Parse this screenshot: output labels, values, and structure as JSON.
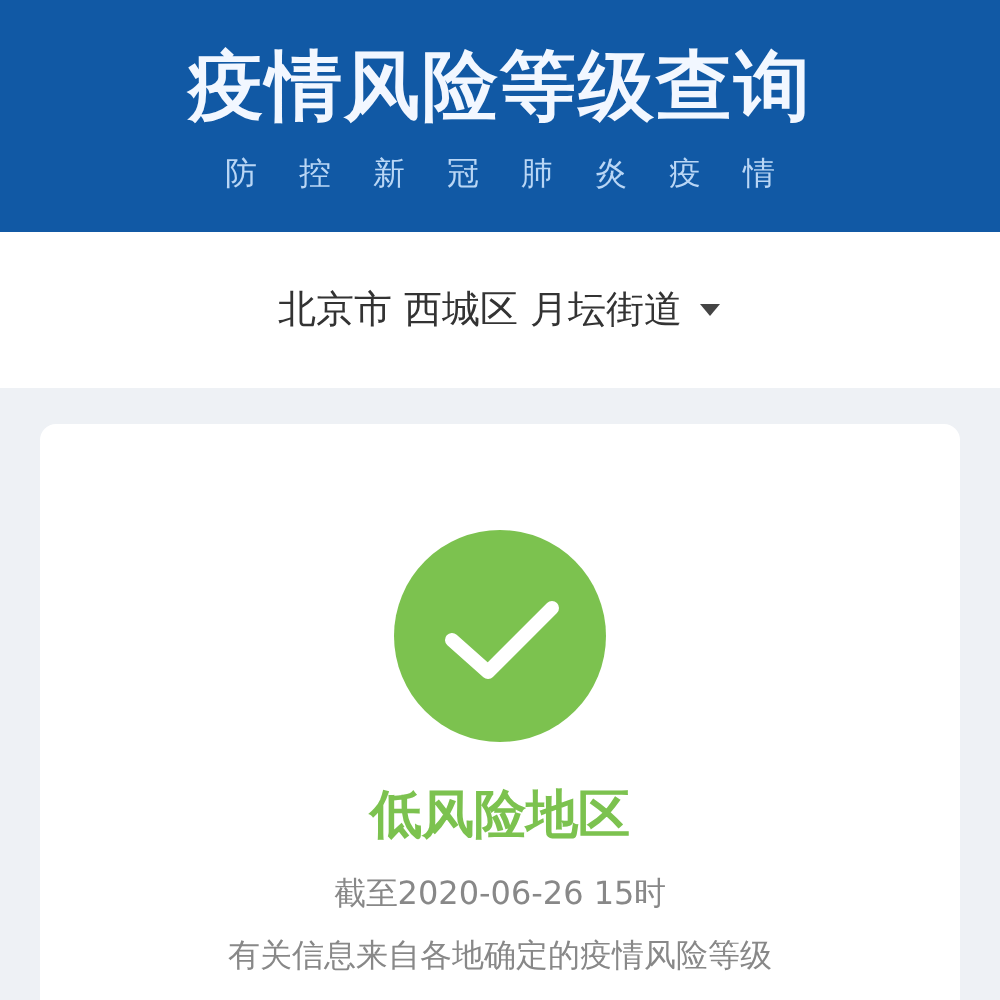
{
  "header": {
    "title": "疫情风险等级查询",
    "subtitle": [
      "防",
      "控",
      "新",
      "冠",
      "肺",
      "炎",
      "疫",
      "情"
    ]
  },
  "location": {
    "city": "北京市",
    "district": "西城区",
    "street": "月坛街道"
  },
  "result": {
    "kind": "low",
    "label": "低风险地区",
    "as_of": "截至2020-06-26 15时",
    "note": "有关信息来自各地确定的疫情风险等级"
  }
}
